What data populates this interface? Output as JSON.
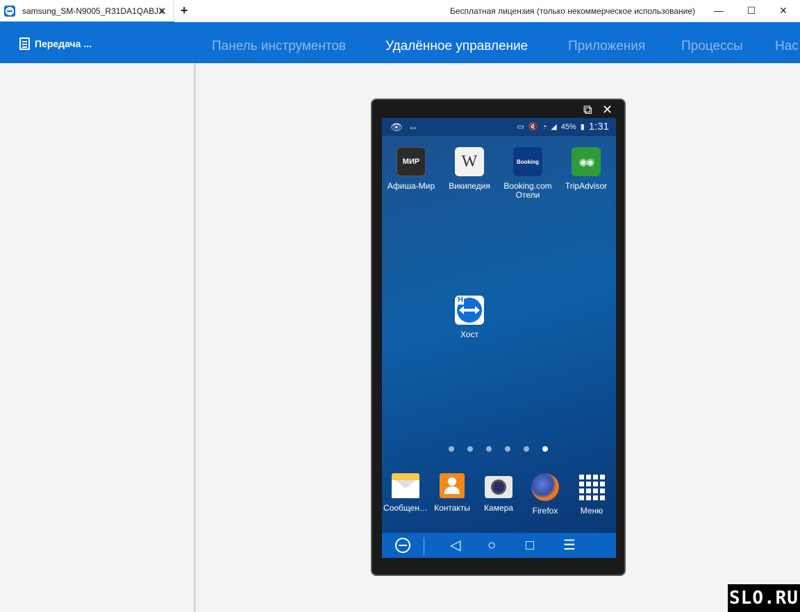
{
  "tab": {
    "title": "samsung_SM-N9005_R31DA1QABJX",
    "close": "✕",
    "new": "+"
  },
  "license_text": "Бесплатная лицензия (только некоммерческое использование)",
  "window": {
    "minimize": "—",
    "maximize": "☐",
    "close": "✕"
  },
  "transfer": {
    "label": "Передача ..."
  },
  "nav": [
    {
      "label": "Панель инструментов",
      "active": false
    },
    {
      "label": "Удалённое управление",
      "active": true
    },
    {
      "label": "Приложения",
      "active": false
    },
    {
      "label": "Процессы",
      "active": false
    },
    {
      "label": "Нас",
      "active": false
    }
  ],
  "phone_controls": {
    "popout": "⧉",
    "close": "✕"
  },
  "statusbar": {
    "battery": "45%",
    "time": "1:31"
  },
  "apps_top": [
    {
      "label": "Афиша-Мир",
      "icon_text": "МИР",
      "icon": "afisha-mir-icon",
      "bg": "#2b2b2b",
      "fg": "#ffffff"
    },
    {
      "label": "Википедия",
      "icon_text": "W",
      "icon": "wikipedia-icon",
      "bg": "#f2f2f2",
      "fg": "#333333"
    },
    {
      "label": "Booking.com\nОтели",
      "icon_text": "Booking",
      "icon": "booking-icon",
      "bg": "#0b3a84",
      "fg": "#ffffff"
    },
    {
      "label": "TripAdvisor",
      "icon_text": "◉◉",
      "icon": "tripadvisor-icon",
      "bg": "#2e9a3a",
      "fg": "#ffffff"
    }
  ],
  "app_host": {
    "label": "Хост",
    "icon_text": "H",
    "icon": "teamviewer-host-icon"
  },
  "dock": [
    {
      "label": "Сообщен…",
      "icon": "messages-icon"
    },
    {
      "label": "Контакты",
      "icon": "contacts-icon"
    },
    {
      "label": "Камера",
      "icon": "camera-icon"
    },
    {
      "label": "Firefox",
      "icon": "firefox-icon"
    },
    {
      "label": "Меню",
      "icon": "menu-grid-icon"
    }
  ],
  "page_dots": {
    "count": 6,
    "active_index": 5
  },
  "watermark": "SLO.RU",
  "colors": {
    "accent": "#0e6fd4",
    "nav_inactive": "#8fb8e8"
  }
}
